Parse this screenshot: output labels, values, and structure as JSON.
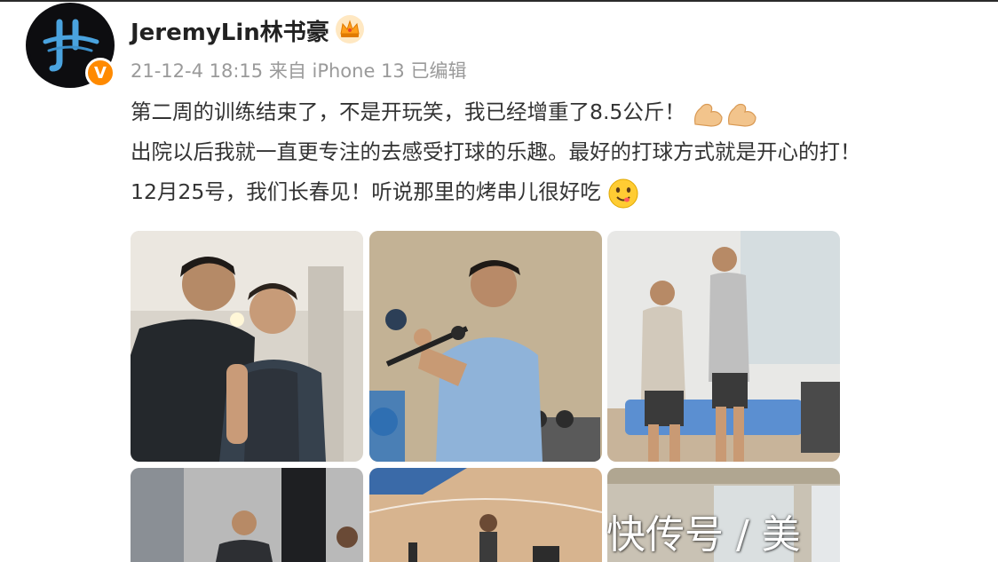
{
  "post": {
    "username": "JeremyLin林书豪",
    "meta": "21-12-4 18:15  来自 iPhone 13 已编辑",
    "lines": [
      "第二周的训练结束了，不是开玩笑，我已经增重了8.5公斤！",
      "出院以后我就一直更专注的去感受打球的乐趣。最好的打球方式就是开心的打！",
      "12月25号，我们长春见！听说那里的烤串儿很好吃"
    ],
    "verified_badge": "V"
  },
  "icons": {
    "crown": "crown-icon",
    "muscle": "flexed-biceps-emoji",
    "yum": "yum-face-emoji"
  },
  "colors": {
    "verified": "#ff8a00",
    "avatar_logo": "#4aa3df"
  },
  "watermark": "快传号 / 美"
}
